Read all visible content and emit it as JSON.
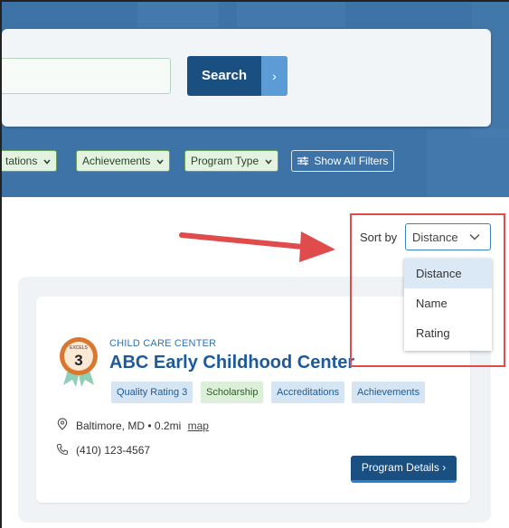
{
  "search": {
    "input_value": "",
    "button_label": "Search",
    "button_chevron": "›"
  },
  "filters": [
    {
      "label": "tations",
      "icon": "chevron-down-icon"
    },
    {
      "label": "Achievements",
      "icon": "chevron-down-icon"
    },
    {
      "label": "Program Type",
      "icon": "chevron-down-icon"
    },
    {
      "label": "Show All Filters",
      "icon": "sliders-icon"
    }
  ],
  "sort": {
    "label": "Sort by",
    "selected": "Distance",
    "options": [
      "Distance",
      "Name",
      "Rating"
    ],
    "active_index": 0
  },
  "result": {
    "badge_text": "EXCELS",
    "badge_number": "3",
    "type": "CHILD CARE CENTER",
    "name": "ABC Early Childhood Center",
    "tags": [
      "Quality Rating 3",
      "Scholarship",
      "Accreditations",
      "Achievements"
    ],
    "location": "Baltimore, MD",
    "separator": "•",
    "distance": "0.2mi",
    "map_link": "map",
    "phone": "(410) 123-4567",
    "details_button": "Program Details",
    "details_chevron": "›"
  },
  "colors": {
    "hero_blue": "#3d73a7",
    "primary_button": "#1a4f82",
    "annotation_red": "#e04b4b",
    "filter_green": "#e4f2e2",
    "tag_blue": "#d6e5f3",
    "tag_green": "#dcefd9",
    "badge_orange": "#d9772f"
  }
}
